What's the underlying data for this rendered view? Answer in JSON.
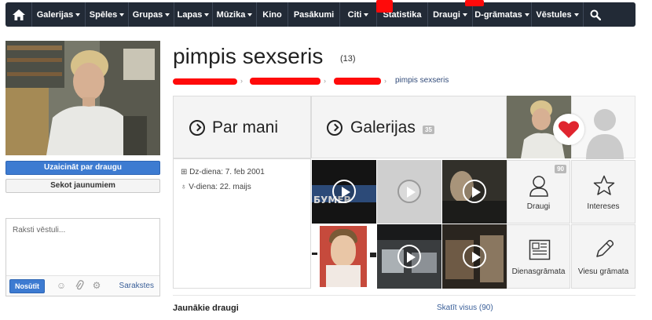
{
  "nav": {
    "items": [
      {
        "label": "Galerijas",
        "dropdown": true
      },
      {
        "label": "Spēles",
        "dropdown": true
      },
      {
        "label": "Grupas",
        "dropdown": true
      },
      {
        "label": "Lapas",
        "dropdown": true
      },
      {
        "label": "Mūzika",
        "dropdown": true
      },
      {
        "label": "Kino",
        "dropdown": false
      },
      {
        "label": "Pasākumi",
        "dropdown": false
      },
      {
        "label": "Citi",
        "dropdown": true
      },
      {
        "label": "Statistika",
        "dropdown": false
      },
      {
        "label": "Draugi",
        "dropdown": true
      },
      {
        "label": "D-grāmatas",
        "dropdown": true
      },
      {
        "label": "Vēstules",
        "dropdown": true
      }
    ],
    "home_icon": "home-icon",
    "search_icon": "search-icon"
  },
  "sidebar": {
    "invite_button": "Uzaicināt par draugu",
    "follow_button": "Sekot jaunumiem",
    "message_placeholder": "Raksti vēstuli...",
    "send_button": "Nosūtīt",
    "list_link": "Sarakstes"
  },
  "profile": {
    "name": "pimpis sexseris",
    "count": "(13)",
    "breadcrumb_last": "pimpis sexseris"
  },
  "tiles": {
    "about": "Par mani",
    "galleries": "Galerijas",
    "galleries_count": "35",
    "birthday": "Dz-diena: 7. feb 2001",
    "nameday": "V-diena: 22. maijs",
    "friends": "Draugi",
    "friends_count": "90",
    "interests": "Intereses",
    "diary": "Dienasgrāmata",
    "guestbook": "Viesu grāmata"
  },
  "bottom": {
    "title": "Jaunākie draugi",
    "link": "Skatīt visus (90)"
  },
  "colors": {
    "nav_bg": "#222a36",
    "primary": "#3d7bd1",
    "heart": "#e0252f",
    "scribble": "#ff0a0a"
  }
}
